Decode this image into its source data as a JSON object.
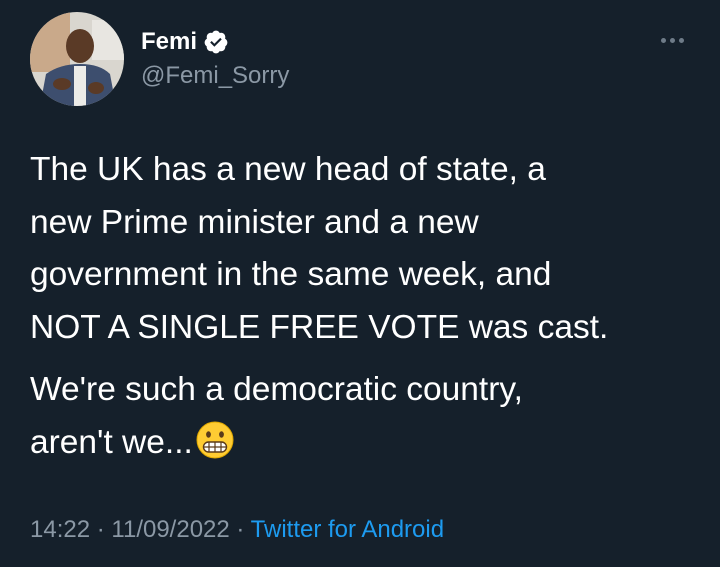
{
  "tweet": {
    "author": {
      "display_name": "Femi",
      "handle": "@Femi_Sorry",
      "verified_icon": "verified-badge-icon",
      "avatar": "profile-photo"
    },
    "more_icon": "more-options-icon",
    "paragraphs": [
      {
        "lines": [
          "The UK has a new head of state, a",
          "new Prime minister and a new",
          "government in the same week, and",
          "NOT A SINGLE FREE VOTE was cast."
        ]
      },
      {
        "lines": [
          "We're such a democratic country,",
          "aren't we..."
        ],
        "emoji": "grimacing-face-emoji"
      }
    ],
    "meta": {
      "time": "14:22",
      "date": "11/09/2022",
      "separator": "·",
      "source": "Twitter for Android"
    }
  },
  "colors": {
    "background": "#15202b",
    "text": "#ffffff",
    "secondary_text": "#8b98a5",
    "link": "#1d9bf0",
    "verified_badge": "#ffffff"
  }
}
